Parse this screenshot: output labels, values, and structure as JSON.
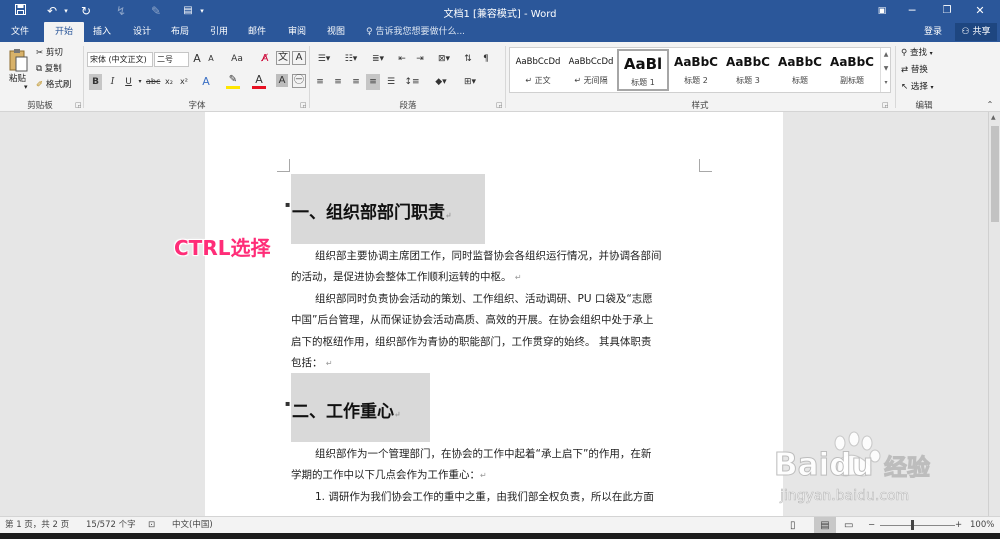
{
  "title_bar": {
    "title": "文档1 [兼容模式] - Word",
    "qat": {
      "save_icon": "save-icon",
      "undo_icon": "undo-icon",
      "redo_icon": "redo-icon",
      "customize_icon": "customize-icon"
    }
  },
  "tabs": [
    {
      "label": "文件"
    },
    {
      "label": "开始"
    },
    {
      "label": "插入"
    },
    {
      "label": "设计"
    },
    {
      "label": "布局"
    },
    {
      "label": "引用"
    },
    {
      "label": "邮件"
    },
    {
      "label": "审阅"
    },
    {
      "label": "视图"
    }
  ],
  "tell_me": "告诉我您想要做什么...",
  "account": {
    "login": "登录",
    "share": "共享"
  },
  "clipboard": {
    "paste": "粘贴",
    "cut": "剪切",
    "copy": "复制",
    "format_painter": "格式刷",
    "group": "剪贴板"
  },
  "font": {
    "name": "宋体 (中文正文)",
    "size": "二号",
    "grow": "A",
    "shrink": "A",
    "case": "Aa",
    "group": "字体"
  },
  "paragraph": {
    "group": "段落"
  },
  "styles": {
    "group": "样式",
    "items": [
      {
        "preview": "AaBbCcDd",
        "name": "正文"
      },
      {
        "preview": "AaBbCcDd",
        "name": "无间隔"
      },
      {
        "preview": "AaBl",
        "name": "标题 1"
      },
      {
        "preview": "AaBbC",
        "name": "标题 2"
      },
      {
        "preview": "AaBbC",
        "name": "标题 3"
      },
      {
        "preview": "AaBbC",
        "name": "标题"
      },
      {
        "preview": "AaBbC",
        "name": "副标题"
      }
    ]
  },
  "editing": {
    "find": "查找",
    "replace": "替换",
    "select": "选择",
    "group": "编辑"
  },
  "document": {
    "heading1": "一、组织部部门职责",
    "para1": [
      "组织部主要协调主席团工作，同时监督协会各组织运行情况，并协调各部间",
      "的活动，是促进协会整体工作顺利运转的中枢。"
    ],
    "para2": [
      "组织部同时负责协会活动的策划、工作组织、活动调研、PU 口袋及“志愿",
      "中国”后台管理，从而保证协会活动高质、高效的开展。在协会组织中处于承上",
      "启下的枢纽作用，组织部作为青协的职能部门，工作贯穿的始终。 其具体职责",
      "包括："
    ],
    "heading2": "二、工作重心",
    "para3": [
      "组织部作为一个管理部门，在协会的工作中起着“承上启下”的作用，在新",
      "学期的工作中以下几点会作为工作重心："
    ],
    "para4": "1. 调研作为我们协会工作的重中之重，由我们部全权负责，所以在此方面"
  },
  "annotation": "CTRL选择",
  "status": {
    "page": "第 1 页，共 2 页",
    "words": "15/572 个字",
    "language": "中文(中国)",
    "zoom": "100%"
  },
  "watermark": {
    "brand": "Baidu",
    "jingyan": "经验",
    "url": "jingyan.baidu.com"
  }
}
